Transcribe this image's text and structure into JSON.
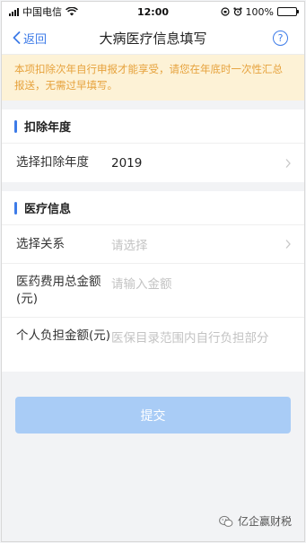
{
  "status_bar": {
    "carrier": "中国电信",
    "time": "12:00",
    "battery": "100%",
    "battery_level": 1.0
  },
  "nav": {
    "back_label": "返回",
    "title": "大病医疗信息填写",
    "help_icon": "?"
  },
  "notice": "本项扣除次年自行申报才能享受，请您在年底时一次性汇总报送，无需过早填写。",
  "deduction_year": {
    "title": "扣除年度",
    "row_label": "选择扣除年度",
    "row_value": "2019"
  },
  "medical_info": {
    "title": "医疗信息",
    "relation_label": "选择关系",
    "relation_placeholder": "请选择",
    "total_cost_label": "医药费用总金额(元)",
    "total_cost_placeholder": "请输入金额",
    "personal_amount_label": "个人负担金额(元)",
    "personal_amount_placeholder": "医保目录范围内自行负担部分"
  },
  "submit_label": "提交",
  "watermark": "亿企赢财税",
  "colors": {
    "accent": "#3d7be8",
    "notice_bg": "#fdf2d6",
    "notice_text": "#e6a23c",
    "submit_disabled": "#a9ccf6"
  }
}
